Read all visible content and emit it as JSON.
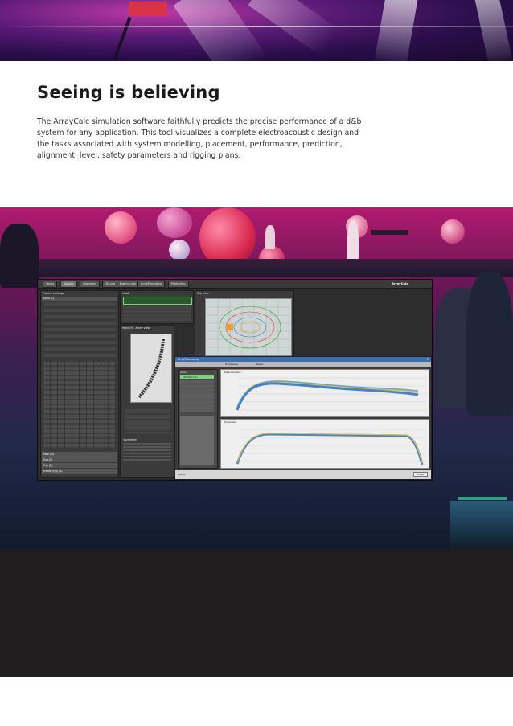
{
  "article": {
    "headline": "Seeing is believing",
    "body": "The ArrayCalc simulation software faithfully predicts the precise performance of a d&b system for any application. This tool visualizes a complete electroacoustic design and the tasks associated with system modelling, placement, performance, prediction, alignment, level, safety parameters and rigging plans."
  },
  "app_screenshot": {
    "tabs": [
      {
        "label": "Venue"
      },
      {
        "label": "Sources"
      },
      {
        "label": "Alignment"
      },
      {
        "label": "3D plot"
      },
      {
        "label": "Rigging plot"
      },
      {
        "label": "ArrayProcessing"
      },
      {
        "label": "Production"
      }
    ],
    "brand": "ArrayCalc",
    "left_panel_title": "Project settings",
    "main_section": "Main (L)",
    "sections_bottom": [
      {
        "label": "Main (R)"
      },
      {
        "label": "Sub (L)"
      },
      {
        "label": "Sub (R)"
      },
      {
        "label": "Frame (Y/R) (1)"
      }
    ],
    "load_panel_title": "Load",
    "array_view_title": "Main (R): Array view",
    "top_view_title": "Top view",
    "comments_title": "Comments",
    "popup": {
      "title": "ArrayProcessing",
      "tabs": [
        {
          "label": "Processing"
        },
        {
          "label": "Result"
        }
      ],
      "list_header": "Select",
      "selected_item": "SPL Main (1)",
      "graph1_title": "Measurement",
      "graph2_title": "Processed",
      "close_label": "Close",
      "status": "Status"
    },
    "colors": {
      "selection_green": "#7bd37a",
      "curve_blue": "#2c6fbf",
      "curve_yellow": "#d8c44a"
    }
  }
}
